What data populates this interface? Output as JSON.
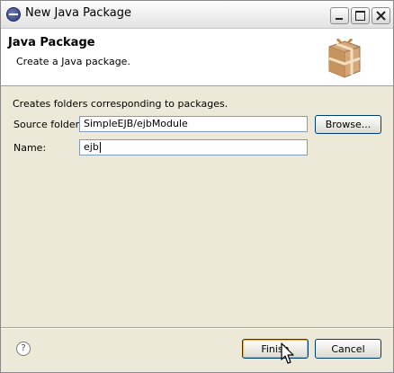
{
  "window": {
    "title": "New Java Package",
    "icon": "eclipse-icon"
  },
  "banner": {
    "title": "Java Package",
    "description": "Create a Java package.",
    "icon": "package-icon"
  },
  "form": {
    "description": "Creates folders corresponding to packages.",
    "source_folder_label": "Source folder:",
    "source_folder_value": "SimpleEJB/ejbModule",
    "browse_label": "Browse...",
    "name_label": "Name:",
    "name_value": "ejb"
  },
  "footer": {
    "help_symbol": "?",
    "finish_label": "Finish",
    "cancel_label": "Cancel"
  },
  "colors": {
    "dialog_bg": "#ece9d8",
    "banner_bg": "#ffffff",
    "button_border": "#003c74"
  }
}
